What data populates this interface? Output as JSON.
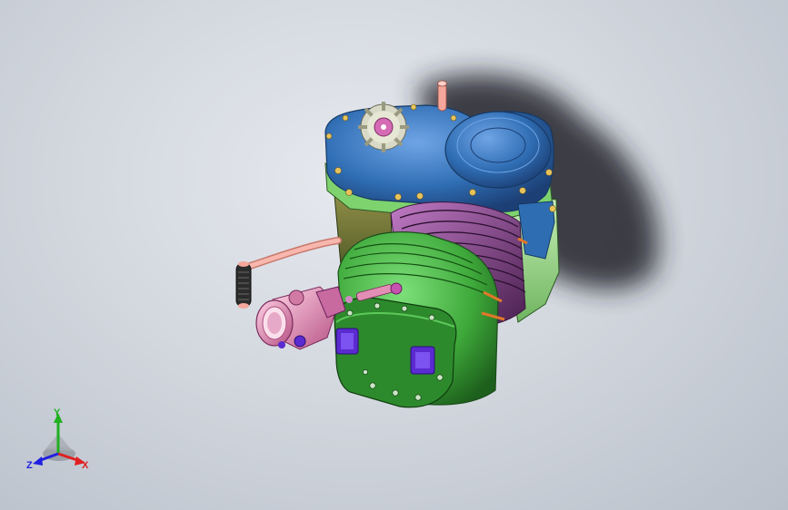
{
  "viewport": {
    "background_top": "#e6e9ee",
    "background_bottom": "#b9c0ca"
  },
  "model": {
    "crankcase_color": "#2f6db3",
    "cylinder_color": "#3ea83a",
    "fins_color": "#8a4c8c",
    "head_bolt_pads_color": "#5a2bd0",
    "intake_color": "#e38fb5",
    "fuel_line_color": "#f4a79a",
    "sprocket_color": "#d9d9c8"
  },
  "triad": {
    "x_label": "X",
    "y_label": "Y",
    "z_label": "Z",
    "x_color": "#e02020",
    "y_color": "#20b020",
    "z_color": "#2020e0"
  }
}
